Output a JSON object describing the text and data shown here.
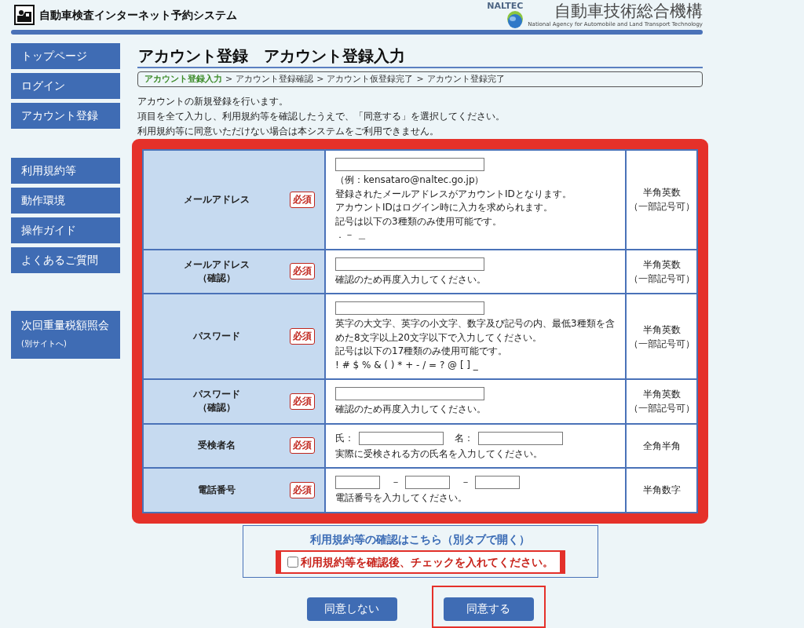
{
  "header": {
    "title": "自動車検査インターネット予約システム",
    "org_abbr": "NALTEC",
    "org_name": "自動車技術総合機構",
    "org_subtitle": "National Agency for Automobile and Land Transport Technology"
  },
  "sidebar": {
    "groups": [
      {
        "items": [
          {
            "label": "トップページ"
          },
          {
            "label": "ログイン"
          },
          {
            "label": "アカウント登録"
          }
        ]
      },
      {
        "items": [
          {
            "label": "利用規約等"
          },
          {
            "label": "動作環境"
          },
          {
            "label": "操作ガイド"
          },
          {
            "label": "よくあるご質問"
          }
        ]
      },
      {
        "items": [
          {
            "label": "次回重量税額照会",
            "note": "(別サイトへ)"
          }
        ]
      }
    ]
  },
  "page_title": "アカウント登録　アカウント登録入力",
  "breadcrumb": {
    "separator": ">",
    "steps": [
      {
        "label": "アカウント登録入力",
        "current": true
      },
      {
        "label": "アカウント登録確認",
        "current": false
      },
      {
        "label": "アカウント仮登録完了",
        "current": false
      },
      {
        "label": "アカウント登録完了",
        "current": false
      }
    ]
  },
  "intro": [
    "アカウントの新規登録を行います。",
    "項目を全て入力し、利用規約等を確認したうえで、「同意する」を選択してください。",
    "利用規約等に同意いただけない場合は本システムをご利用できません。"
  ],
  "form": {
    "highlighted": true,
    "rows": [
      {
        "label": [
          "メールアドレス"
        ],
        "badge": "必須",
        "inputs": [
          {
            "kind": "input"
          }
        ],
        "notes": [
          "（例：kensataro@naltec.go.jp）",
          "登録されたメールアドレスがアカウントIDとなります。",
          "アカウントIDはログイン時に入力を求められます。",
          "記号は以下の3種類のみ使用可能です。",
          "．－ ＿"
        ],
        "char_type": [
          "半角英数",
          "（一部記号可）"
        ]
      },
      {
        "label": [
          "メールアドレス",
          "（確認）"
        ],
        "badge": "必須",
        "inputs": [
          {
            "kind": "input"
          }
        ],
        "notes": [
          "確認のため再度入力してください。"
        ],
        "char_type": [
          "半角英数",
          "（一部記号可）"
        ]
      },
      {
        "label": [
          "パスワード"
        ],
        "badge": "必須",
        "inputs": [
          {
            "kind": "input"
          }
        ],
        "notes": [
          "英字の大文字、英字の小文字、数字及び記号の内、最低3種類を含めた8文字以上20文字以下で入力してください。",
          "記号は以下の17種類のみ使用可能です。",
          "! # $ % & ( ) * + - / = ? @ [ ] _"
        ],
        "char_type": [
          "半角英数",
          "（一部記号可）"
        ]
      },
      {
        "label": [
          "パスワード",
          "（確認）"
        ],
        "badge": "必須",
        "inputs": [
          {
            "kind": "input"
          }
        ],
        "notes": [
          "確認のため再度入力してください。"
        ],
        "char_type": [
          "半角英数",
          "（一部記号可）"
        ]
      },
      {
        "label": [
          "受検者名"
        ],
        "badge": "必須",
        "inputs": [
          {
            "kind": "text",
            "text": "氏："
          },
          {
            "kind": "input"
          },
          {
            "kind": "text",
            "text": "名："
          },
          {
            "kind": "input"
          }
        ],
        "notes": [
          "実際に受検される方の氏名を入力してください。"
        ],
        "char_type": [
          "全角半角"
        ]
      },
      {
        "label": [
          "電話番号"
        ],
        "badge": "必須",
        "inputs": [
          {
            "kind": "input"
          },
          {
            "kind": "text",
            "text": "－"
          },
          {
            "kind": "input"
          },
          {
            "kind": "text",
            "text": "－"
          },
          {
            "kind": "input"
          }
        ],
        "notes": [
          "電話番号を入力してください。"
        ],
        "char_type": [
          "半角数字"
        ]
      }
    ]
  },
  "terms": {
    "link": "利用規約等の確認はこちら（別タブで開く）",
    "checkbox": {
      "label": "利用規約等を確認後、チェックを入れてください。",
      "checked": false
    }
  },
  "buttons": [
    {
      "label": "同意しない",
      "highlighted": false
    },
    {
      "label": "同意する",
      "highlighted": true
    }
  ]
}
